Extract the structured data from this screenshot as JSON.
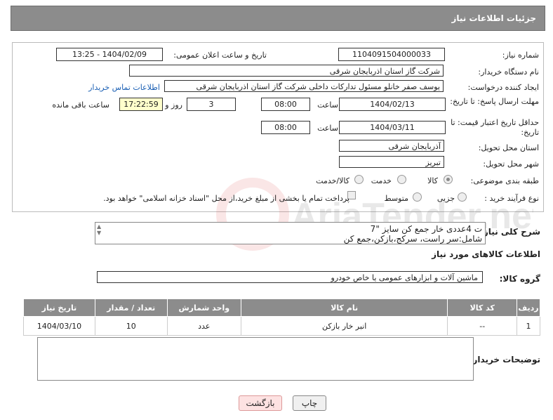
{
  "header": {
    "title": "جزئیات اطلاعات نیاز"
  },
  "form": {
    "need_number_label": "شماره نیاز:",
    "need_number": "1104091504000033",
    "announce_label": "تاریخ و ساعت اعلان عمومی:",
    "announce_value": "1404/02/09 - 13:25",
    "buyer_org_label": "نام دستگاه خریدار:",
    "buyer_org": "شرکت گاز استان اذربایجان شرقی",
    "creator_label": "ایجاد کننده درخواست:",
    "creator": "یوسف صفر خانلو  مسئول تدارکات داخلی  شرکت گاز استان اذربایجان شرقی",
    "contact_link": "اطلاعات تماس خریدار",
    "deadline_label": "مهلت ارسال پاسخ: تا تاریخ:",
    "deadline_date": "1404/02/13",
    "time_label": "ساعت",
    "deadline_time": "08:00",
    "days_value": "3",
    "days_label": "روز و",
    "remaining_time": "17:22:59",
    "remaining_label": "ساعت باقی مانده",
    "price_validity_label": "حداقل تاریخ اعتبار قیمت: تا تاریخ:",
    "price_date": "1404/03/11",
    "price_time": "08:00",
    "province_label": "استان محل تحویل:",
    "province": "آذربایجان شرقی",
    "city_label": "شهر محل تحویل:",
    "city": "تبریز",
    "category_label": "طبقه بندی موضوعی:",
    "category_options": [
      "کالا",
      "خدمت",
      "کالا/خدمت"
    ],
    "category_selected": "کالا",
    "process_label": "نوع فرآیند خرید :",
    "process_options": [
      "جزیی",
      "متوسط"
    ],
    "payment_note": "پرداخت تمام یا بخشی از مبلغ خرید،از محل \"اسناد خزانه اسلامی\" خواهد بود."
  },
  "description": {
    "label": "شرح کلی نیاز:",
    "line1": "ت 4عددی خار جمع کن سایز \"7",
    "line2": "شامل:سر راست، سرکج،بازکن،جمع کن"
  },
  "goods_section_title": "اطلاعات کالاهای مورد نیاز",
  "goods_group": {
    "label": "گروه کالا:",
    "value": "ماشین آلات و ابزارهای عمومی یا خاص خودرو"
  },
  "table": {
    "headers": [
      "ردیف",
      "کد کالا",
      "نام کالا",
      "واحد شمارش",
      "تعداد / مقدار",
      "تاریخ نیاز"
    ],
    "rows": [
      [
        "1",
        "--",
        "انبر خار بازکن",
        "عدد",
        "10",
        "1404/03/10"
      ]
    ]
  },
  "buyer_notes_label": "توضیحات خریدار:",
  "buttons": {
    "print": "چاپ",
    "back": "بازگشت"
  },
  "watermark_text": "AriaTender.net"
}
